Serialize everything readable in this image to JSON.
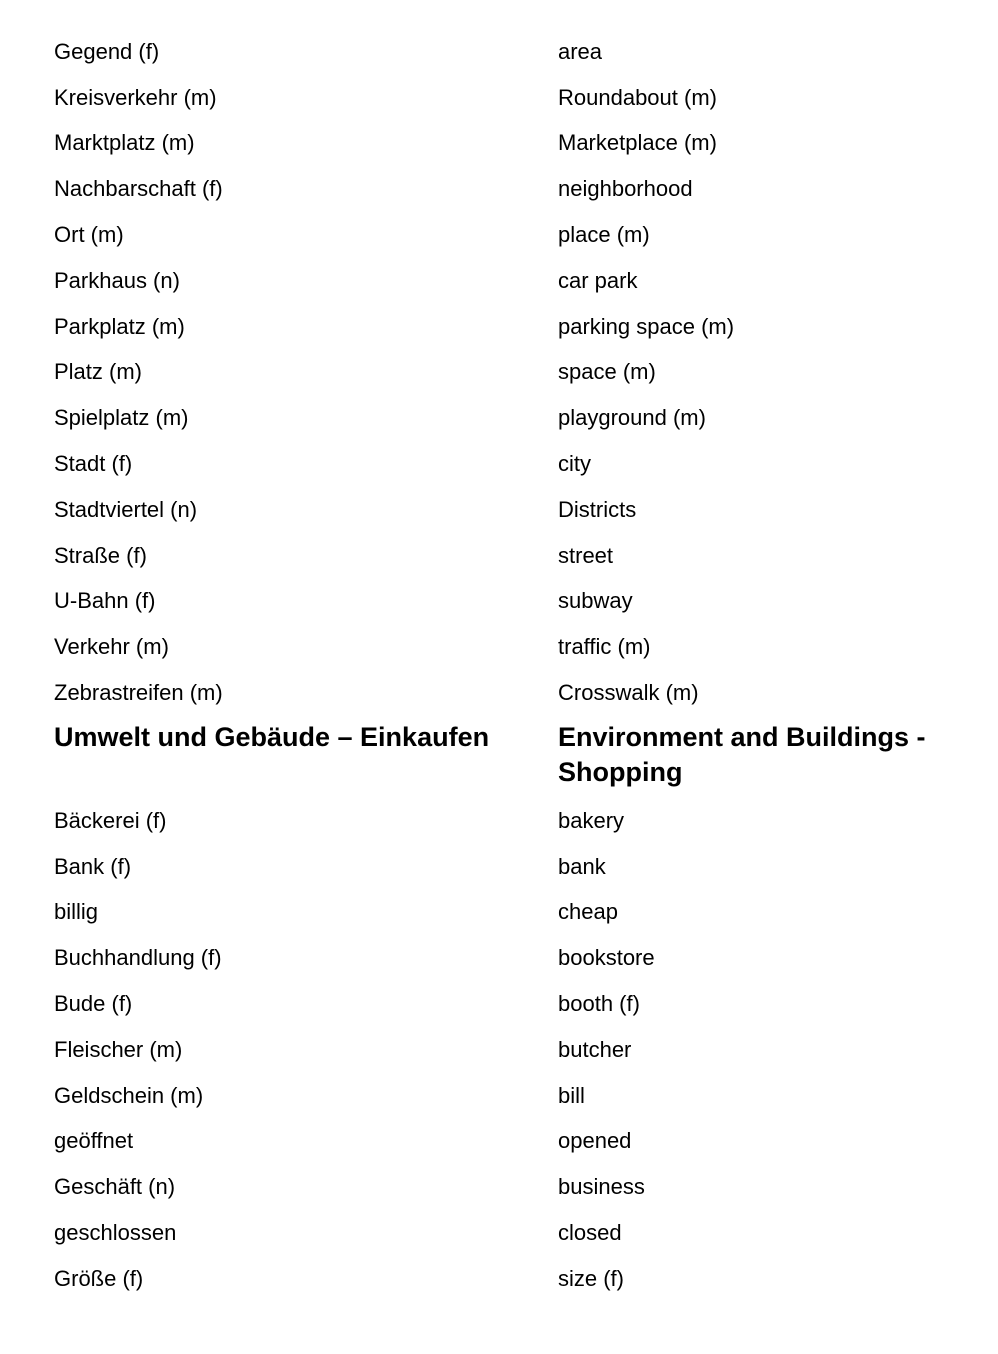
{
  "section1": {
    "rows": [
      {
        "de": "Gegend (f)",
        "en": "area"
      },
      {
        "de": "Kreisverkehr (m)",
        "en": "Roundabout (m)"
      },
      {
        "de": "Marktplatz (m)",
        "en": "Marketplace (m)"
      },
      {
        "de": "Nachbarschaft (f)",
        "en": "neighborhood"
      },
      {
        "de": "Ort (m)",
        "en": "place (m)"
      },
      {
        "de": "Parkhaus (n)",
        "en": "car park"
      },
      {
        "de": "Parkplatz (m)",
        "en": "parking space (m)"
      },
      {
        "de": "Platz (m)",
        "en": "space (m)"
      },
      {
        "de": "Spielplatz (m)",
        "en": "playground (m)"
      },
      {
        "de": "Stadt (f)",
        "en": "city"
      },
      {
        "de": "Stadtviertel (n)",
        "en": "Districts"
      },
      {
        "de": "Straße (f)",
        "en": "street"
      },
      {
        "de": "U-Bahn (f)",
        "en": "subway"
      },
      {
        "de": "Verkehr (m)",
        "en": "traffic (m)"
      },
      {
        "de": "Zebrastreifen (m)",
        "en": "Crosswalk (m)"
      }
    ]
  },
  "section2": {
    "heading_de": "Umwelt und Gebäude – Einkaufen",
    "heading_en": "Environment and Buildings - Shopping",
    "rows": [
      {
        "de": "Bäckerei (f)",
        "en": "bakery"
      },
      {
        "de": "Bank (f)",
        "en": "bank"
      },
      {
        "de": "billig",
        "en": "cheap"
      },
      {
        "de": "Buchhandlung (f)",
        "en": "bookstore"
      },
      {
        "de": "Bude (f)",
        "en": "booth (f)"
      },
      {
        "de": "Fleischer (m)",
        "en": "butcher"
      },
      {
        "de": "Geldschein (m)",
        "en": "bill"
      },
      {
        "de": "geöffnet",
        "en": "opened"
      },
      {
        "de": "Geschäft (n)",
        "en": "business"
      },
      {
        "de": "geschlossen",
        "en": "closed"
      },
      {
        "de": "Größe (f)",
        "en": "size (f)"
      }
    ]
  }
}
